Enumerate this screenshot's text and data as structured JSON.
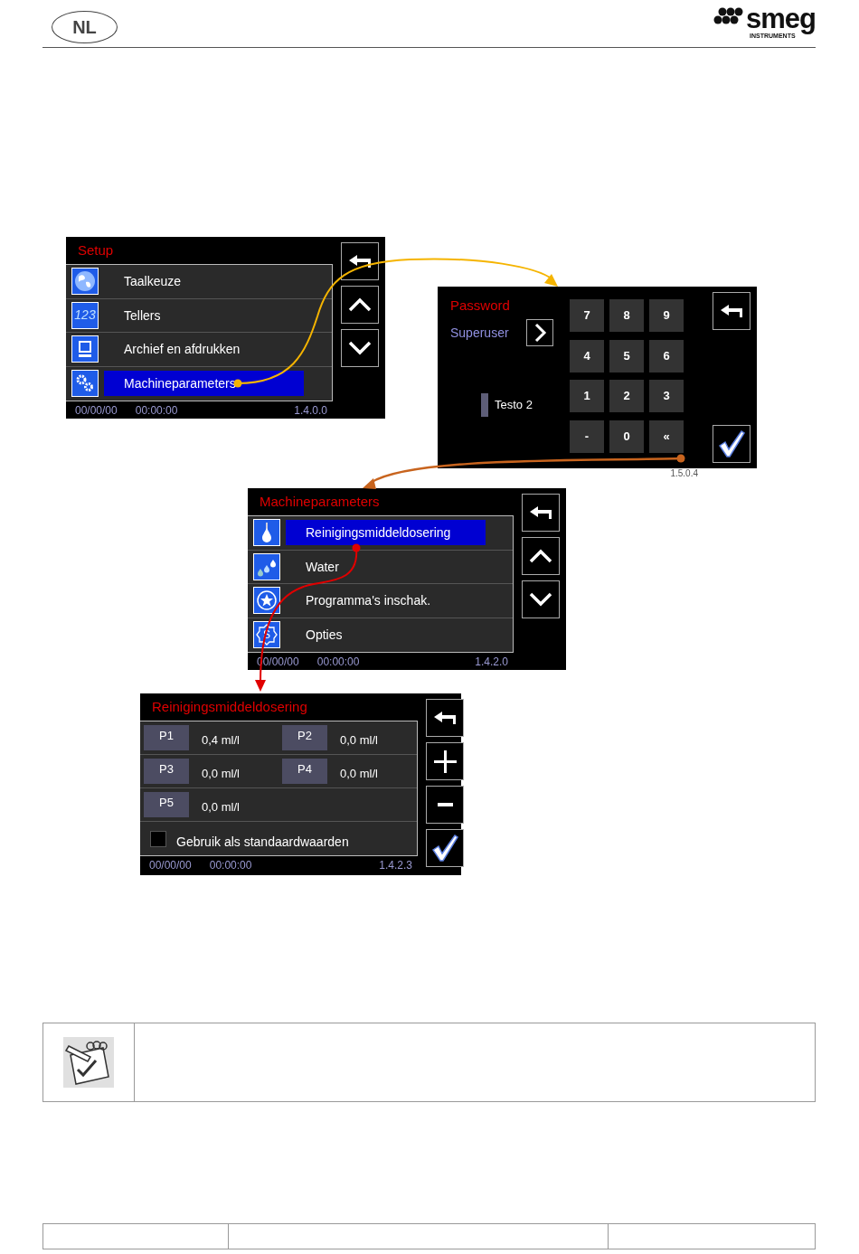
{
  "header": {
    "language": "NL",
    "logo": {
      "name": "smeg",
      "tagline": "INSTRUMENTS"
    }
  },
  "screens": [
    {
      "kind": "menu",
      "title": "Setup",
      "items": [
        {
          "label": "Taalkeuze",
          "selected": false
        },
        {
          "label": "Tellers",
          "icon_label": "123",
          "selected": false
        },
        {
          "label": "Archief en afdrukken",
          "selected": false
        },
        {
          "label": "Machineparameters",
          "selected": true
        }
      ],
      "status": {
        "date": "00/00/00",
        "time": "00:00:00",
        "version": "1.4.0.0"
      }
    },
    {
      "kind": "password",
      "title": "Password",
      "user": "Superuser",
      "field_value": "Testo 2",
      "keys": [
        "7",
        "8",
        "9",
        "4",
        "5",
        "6",
        "1",
        "2",
        "3",
        "-",
        "0",
        "«"
      ],
      "version": "1.5.0.4"
    },
    {
      "kind": "menu",
      "title": "Machineparameters",
      "items": [
        {
          "label": "Reinigingsmiddeldosering",
          "selected": true
        },
        {
          "label": "Water",
          "selected": false
        },
        {
          "label": "Programma's inschak.",
          "selected": false
        },
        {
          "label": "Opties",
          "icon_label": "S",
          "selected": false
        }
      ],
      "status": {
        "date": "00/00/00",
        "time": "00:00:00",
        "version": "1.4.2.0"
      }
    },
    {
      "kind": "dosing",
      "title": "Reinigingsmiddeldosering",
      "params": [
        {
          "label": "P1",
          "value": "0,4 ml/l"
        },
        {
          "label": "P2",
          "value": "0,0 ml/l"
        },
        {
          "label": "P3",
          "value": "0,0 ml/l"
        },
        {
          "label": "P4",
          "value": "0,0 ml/l"
        },
        {
          "label": "P5",
          "value": "0,0 ml/l"
        }
      ],
      "checkbox": {
        "label": "Gebruik als standaardwaarden",
        "checked": false
      },
      "status": {
        "date": "00/00/00",
        "time": "00:00:00",
        "version": "1.4.2.3"
      }
    }
  ]
}
